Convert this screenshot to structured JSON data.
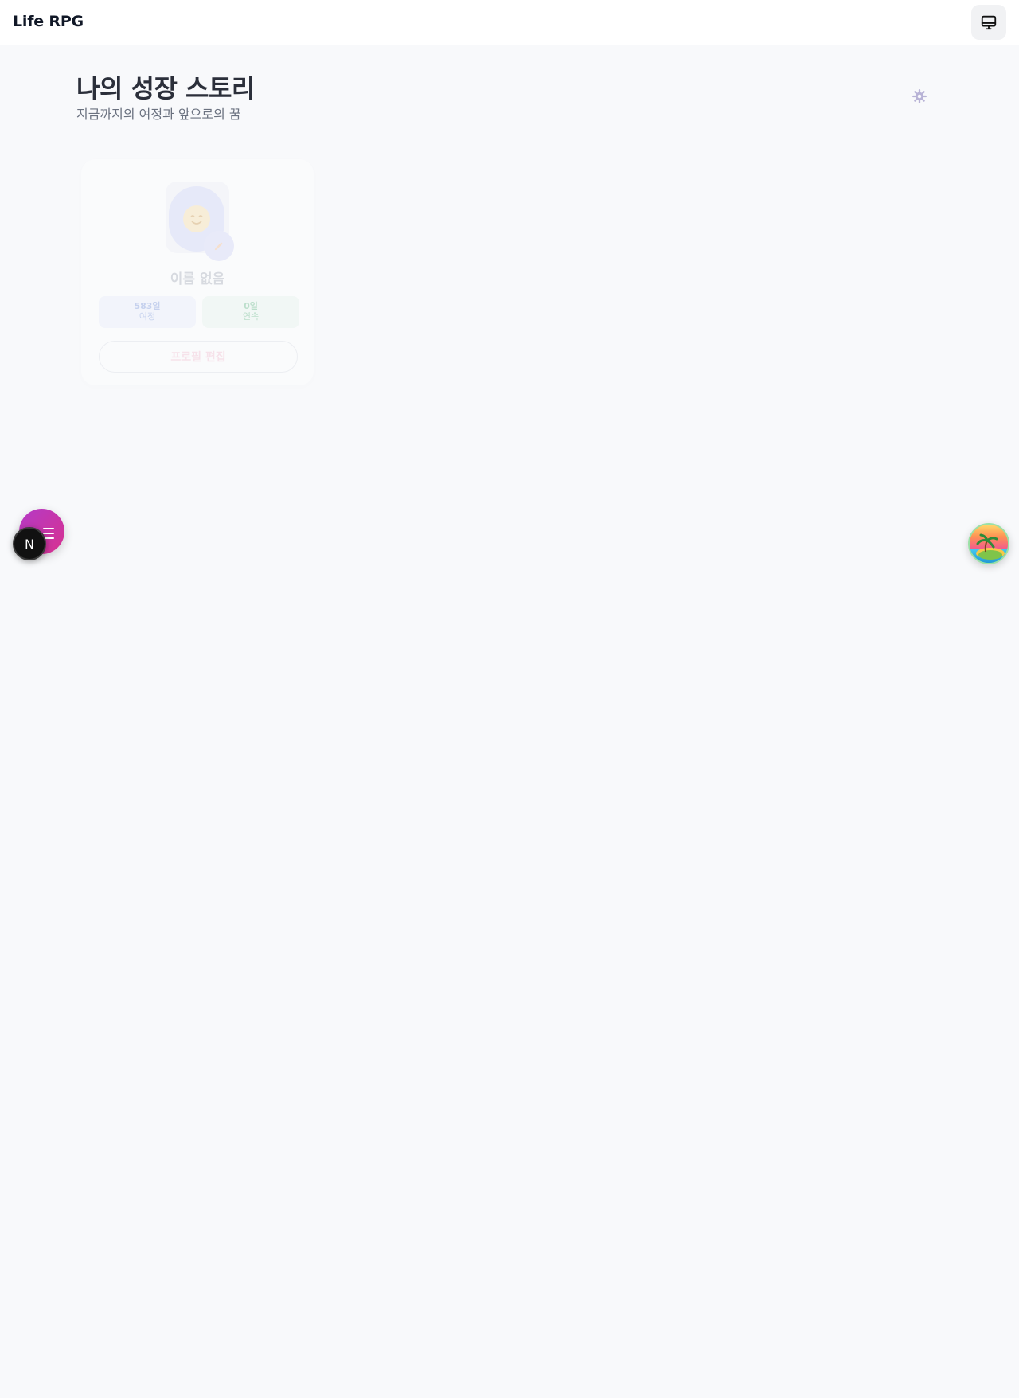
{
  "header": {
    "app_title": "Life RPG",
    "device_icon": "monitor-icon"
  },
  "page": {
    "title": "나의 성장 스토리",
    "subtitle": "지금까지의 여정과 앞으로의 꿈",
    "settings_icon": "gear-icon"
  },
  "profile": {
    "name": "이름 없음",
    "stats": [
      {
        "value": "583일",
        "label": "여정"
      },
      {
        "value": "0일",
        "label": "연속"
      }
    ],
    "edit_button": "프로필 편집",
    "avatar_icon": "smiley-face-icon",
    "edit_icon": "pencil-icon"
  },
  "floating": {
    "menu_icon": "menu-icon",
    "next_badge_letter": "N",
    "island_icon": "island-icon"
  },
  "colors": {
    "accent_gradient_start": "#b43ac7",
    "accent_gradient_end": "#d8318e",
    "background": "#f8f9fb"
  }
}
